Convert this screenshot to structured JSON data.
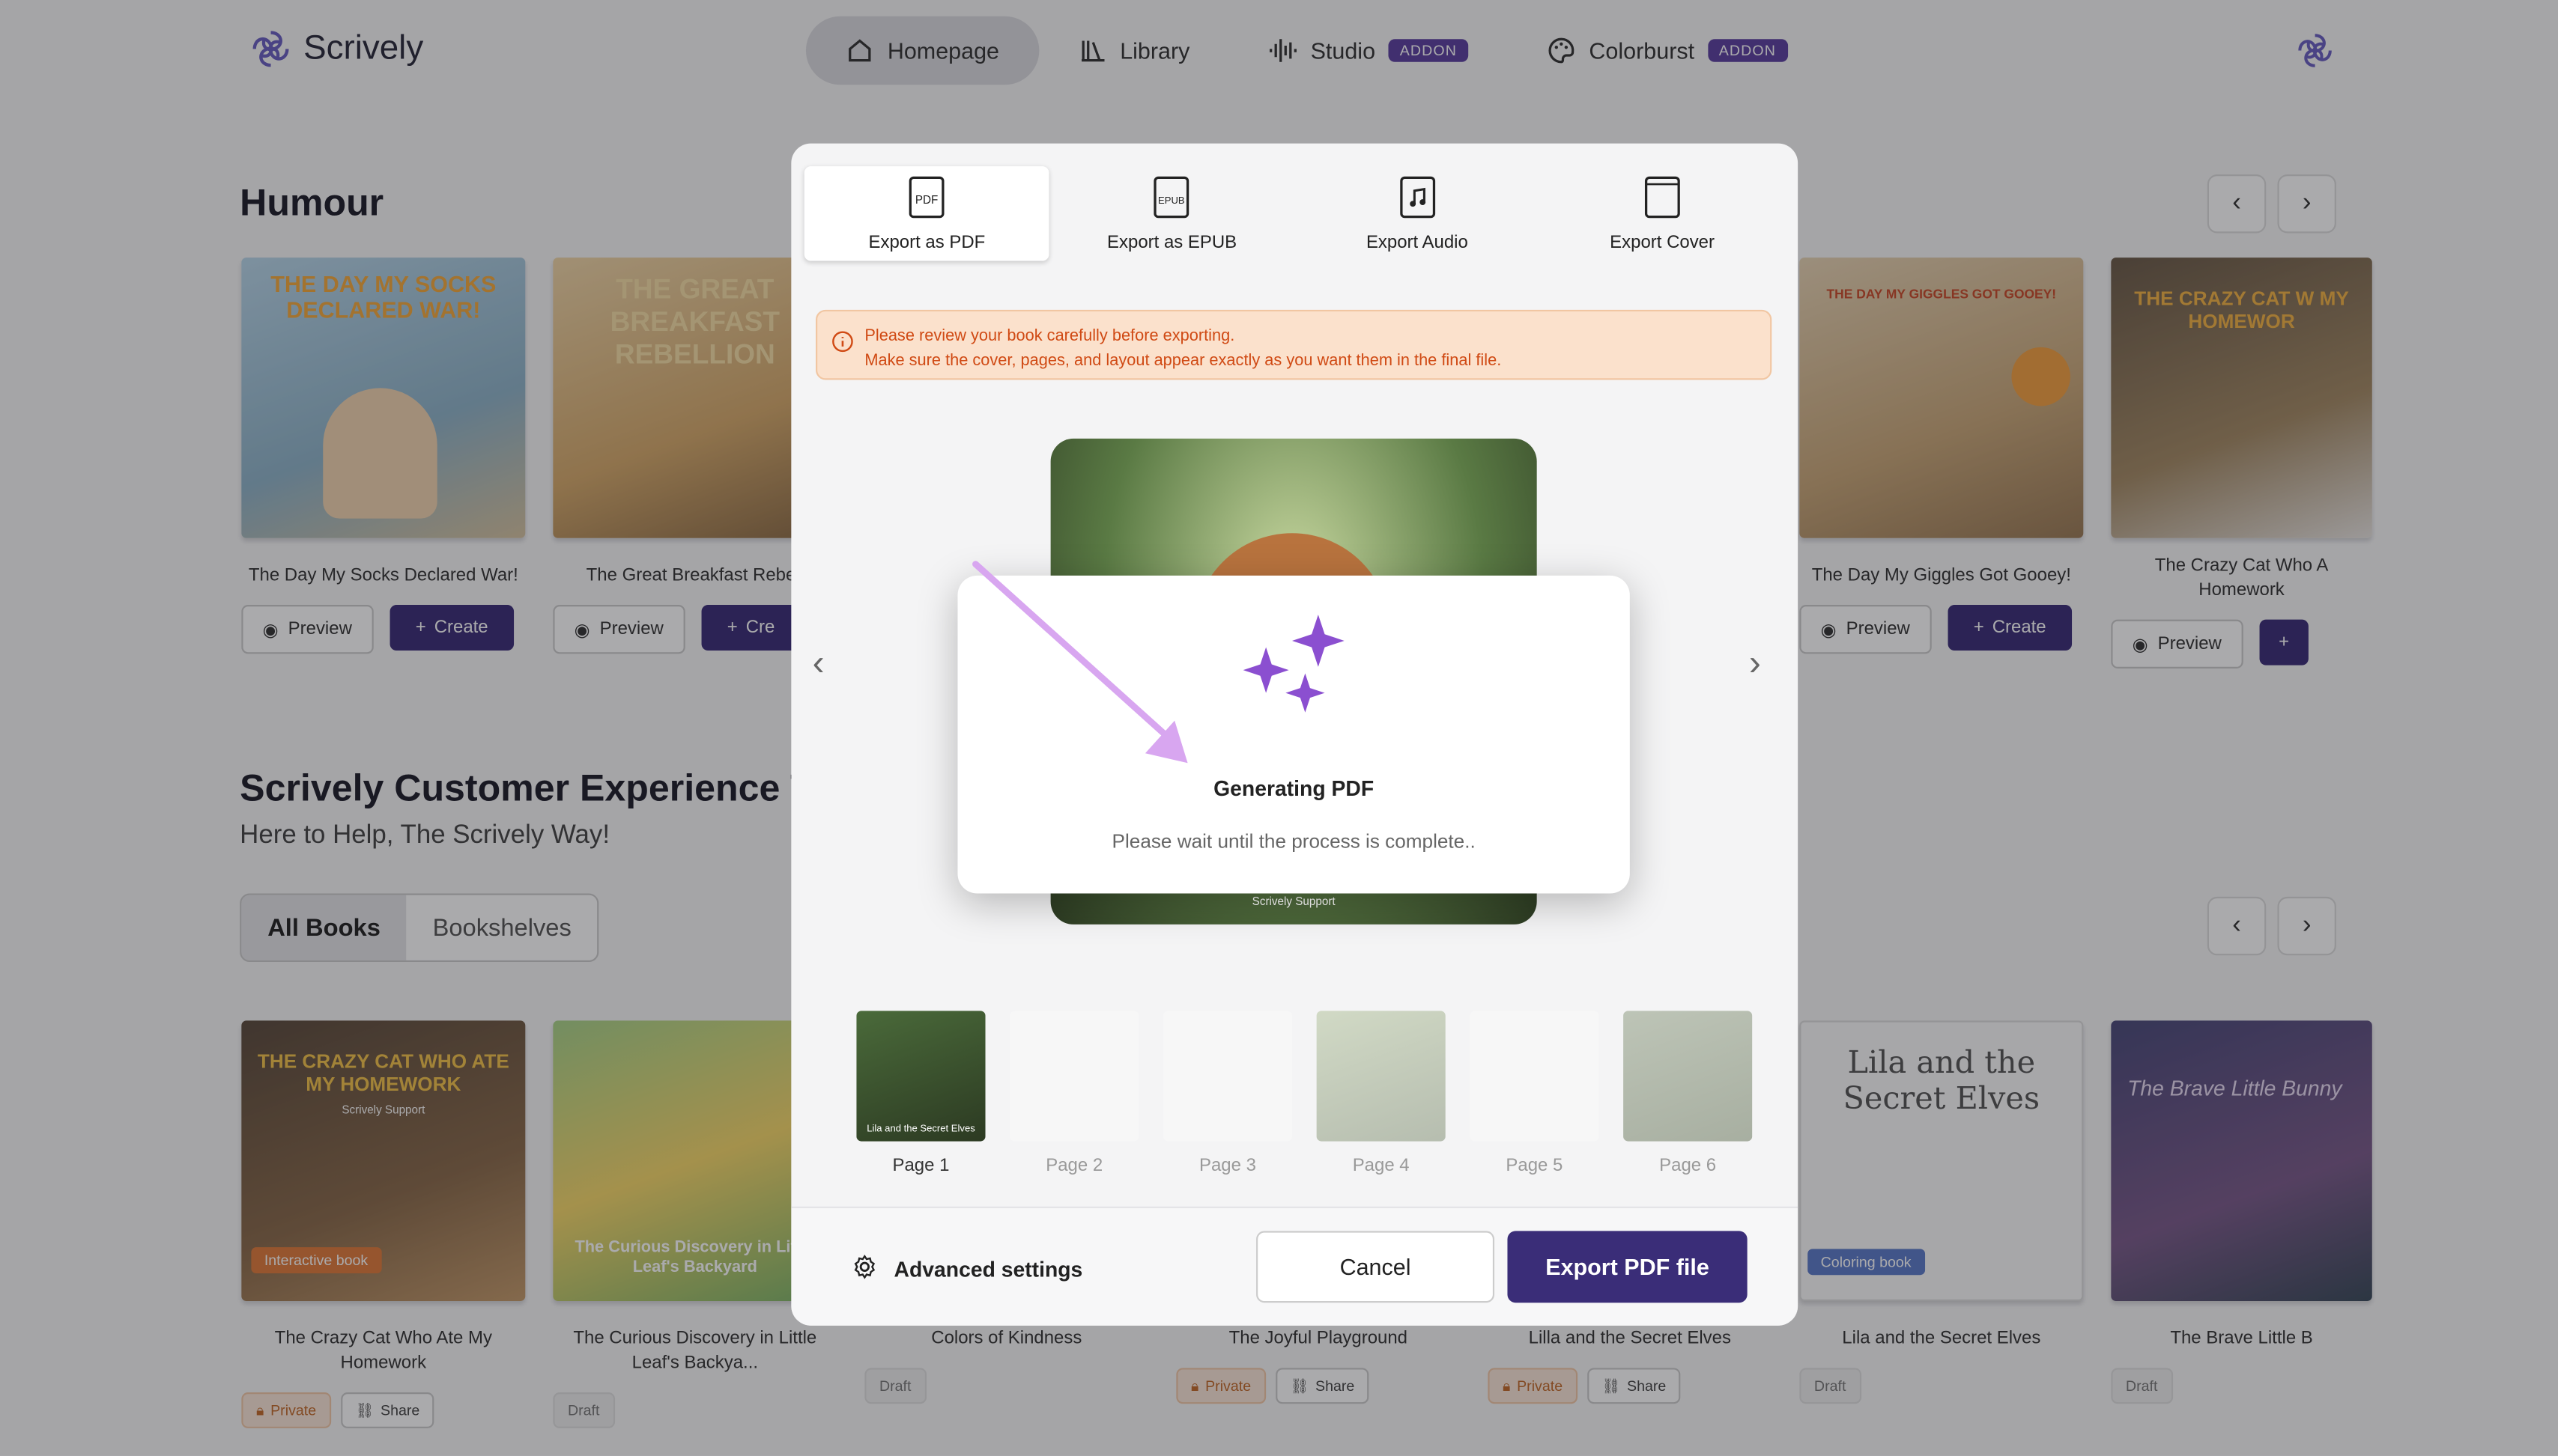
{
  "header": {
    "logo_text": "Scrively",
    "nav": [
      {
        "label": "Homepage"
      },
      {
        "label": "Library"
      },
      {
        "label": "Studio",
        "badge": "ADDON"
      },
      {
        "label": "Colorburst",
        "badge": "ADDON"
      }
    ]
  },
  "section1": {
    "title": "Humour",
    "books": [
      {
        "title": "The Day My Socks Declared War!",
        "cover_text": "THE DAY MY SOCKS DECLARED WAR!"
      },
      {
        "title": "The Great Breakfast Rebell",
        "cover_text": "THE GREAT BREAKFAST REBELLION"
      },
      {
        "title": "The Day My Giggles Got Gooey!",
        "cover_text": "THE DAY MY GIGGLES GOT GOOEY!"
      },
      {
        "title": "The Crazy Cat Who A Homework",
        "cover_text": "THE CRAZY CAT W MY HOMEWOR"
      }
    ],
    "preview_label": "Preview",
    "create_label": "Create",
    "create_short": "Cre"
  },
  "section2": {
    "title": "Scrively Customer Experience Te",
    "subtitle": "Here to Help, The Scrively Way!",
    "toggle": {
      "all": "All Books",
      "shelves": "Bookshelves"
    },
    "books": [
      {
        "title": "The Crazy Cat Who Ate My Homework",
        "cover_text": "THE CRAZY CAT WHO ATE MY HOMEWORK",
        "cover_sub": "Scrively Support",
        "tag": "Interactive book",
        "chips": [
          "Private",
          "Share"
        ]
      },
      {
        "title": "The Curious Discovery in Little Leaf's Backya...",
        "cover_text": "The Curious Discovery in Little Leaf's Backyard",
        "chips": [
          "Draft"
        ]
      },
      {
        "title": "Colors of Kindness",
        "chips": [
          "Draft"
        ]
      },
      {
        "title": "The Joyful Playground",
        "chips": [
          "Private",
          "Share"
        ]
      },
      {
        "title": "Lilla and the Secret Elves",
        "chips": [
          "Private",
          "Share"
        ]
      },
      {
        "title": "Lila and the Secret Elves",
        "cover_text": "Lila and the Secret Elves",
        "tag": "Coloring book",
        "chips": [
          "Draft"
        ]
      },
      {
        "title": "The Brave Little B",
        "cover_text": "The Brave Little Bunny",
        "chips": [
          "Draft"
        ]
      }
    ]
  },
  "export_modal": {
    "tabs": [
      {
        "label": "Export as PDF",
        "icon_text": "PDF"
      },
      {
        "label": "Export as EPUB",
        "icon_text": "EPUB"
      },
      {
        "label": "Export Audio"
      },
      {
        "label": "Export Cover"
      }
    ],
    "warning_line1": "Please review your book carefully before exporting.",
    "warning_line2": "Make sure the cover, pages, and layout appear exactly as you want them in the final file.",
    "preview_footer": "Scrively Support",
    "pages": [
      "Page 1",
      "Page 2",
      "Page 3",
      "Page 4",
      "Page 5",
      "Page 6"
    ],
    "page1_caption": "Lila and the Secret Elves",
    "advanced_label": "Advanced settings",
    "cancel_label": "Cancel",
    "export_label": "Export PDF file"
  },
  "generating": {
    "title": "Generating PDF",
    "message": "Please wait until the process is complete.."
  },
  "colors": {
    "accent": "#3a2d78",
    "badge": "#5b3fa0",
    "sparkle": "#8b4fd0",
    "warning_text": "#d04a14"
  }
}
